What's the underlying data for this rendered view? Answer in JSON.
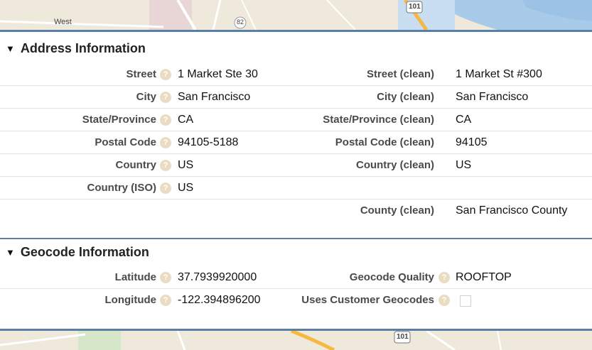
{
  "map_top_labels": {
    "west": "West",
    "route_82": "82",
    "route_101": "101"
  },
  "map_bottom_labels": {
    "route_101": "101"
  },
  "address_section": {
    "title": "Address Information",
    "rows": [
      {
        "left_label": "Street",
        "left_value": "1 Market Ste 30",
        "right_label": "Street (clean)",
        "right_value": "1 Market St #300"
      },
      {
        "left_label": "City",
        "left_value": "San Francisco",
        "right_label": "City (clean)",
        "right_value": "San Francisco"
      },
      {
        "left_label": "State/Province",
        "left_value": "CA",
        "right_label": "State/Province (clean)",
        "right_value": "CA"
      },
      {
        "left_label": "Postal Code",
        "left_value": "94105-5188",
        "right_label": "Postal Code (clean)",
        "right_value": "94105"
      },
      {
        "left_label": "Country",
        "left_value": "US",
        "right_label": "Country (clean)",
        "right_value": "US"
      },
      {
        "left_label": "Country (ISO)",
        "left_value": "US"
      },
      {
        "right_label": "County (clean)",
        "right_value": "San Francisco County"
      }
    ]
  },
  "geocode_section": {
    "title": "Geocode Information",
    "rows": [
      {
        "left_label": "Latitude",
        "left_value": "37.7939920000",
        "right_label": "Geocode Quality",
        "right_value": "ROOFTOP"
      },
      {
        "left_label": "Longitude",
        "left_value": "-122.394896200",
        "right_label": "Uses Customer Geocodes",
        "right_checked": false
      }
    ]
  },
  "help_glyph": "?",
  "icons": {
    "help": "help-icon",
    "collapse": "triangle-down-icon"
  }
}
